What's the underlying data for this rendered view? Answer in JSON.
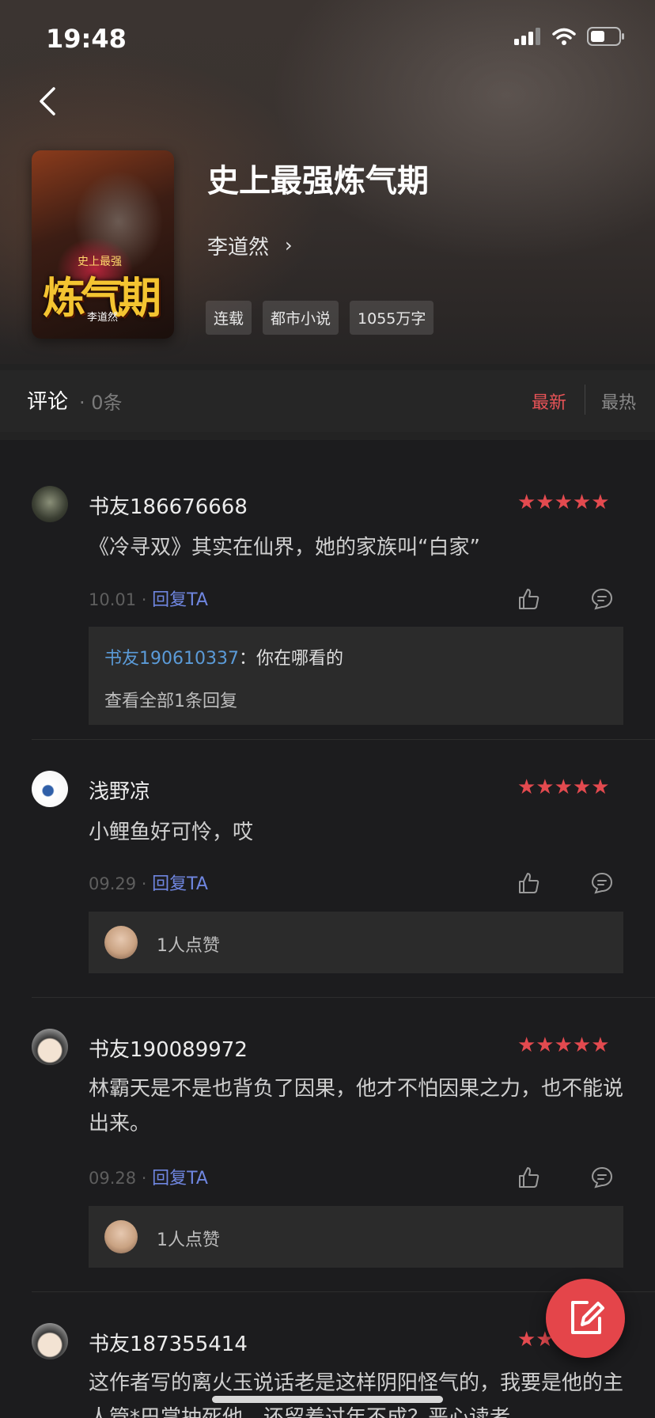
{
  "status": {
    "time": "19:48"
  },
  "book": {
    "title": "史上最强炼气期",
    "author": "李道然",
    "author_chevron": "›",
    "cover": {
      "subtitle": "史上最强",
      "title": "炼气期",
      "author": "李道然"
    },
    "tags": [
      "连载",
      "都市小说",
      "1055万字"
    ]
  },
  "comments_header": {
    "title": "评论",
    "count": "· 0条",
    "sort_new": "最新",
    "sort_hot": "最热"
  },
  "comments": [
    {
      "user": "书友186676668",
      "stars": "★★★★★",
      "text": "《冷寻双》其实在仙界，她的家族叫“白家”",
      "date": "10.01 ·",
      "reply_label": "回复TA",
      "sub_reply": {
        "user": "书友190610337",
        "sep": "：",
        "text": "你在哪看的",
        "view_all": "查看全部1条回复"
      }
    },
    {
      "user": "浅野凉",
      "stars": "★★★★★",
      "text": "小鲤鱼好可怜，哎",
      "date": "09.29 ·",
      "reply_label": "回复TA",
      "likes_text": "1人点赞"
    },
    {
      "user": "书友190089972",
      "stars": "★★★★★",
      "text": "林霸天是不是也背负了因果，他才不怕因果之力，也不能说出来。",
      "date": "09.28 ·",
      "reply_label": "回复TA",
      "likes_text": "1人点赞"
    },
    {
      "user": "书友187355414",
      "stars": "★★★★★",
      "text": "这作者写的离火玉说话老是这样阴阳怪气的，我要是他的主人管*巴掌抽死他，还留着过年不成？恶心读者"
    }
  ],
  "colors": {
    "accent_red": "#e34a4f",
    "link_blue": "#6f86e0",
    "background": "#1c1c1e"
  }
}
